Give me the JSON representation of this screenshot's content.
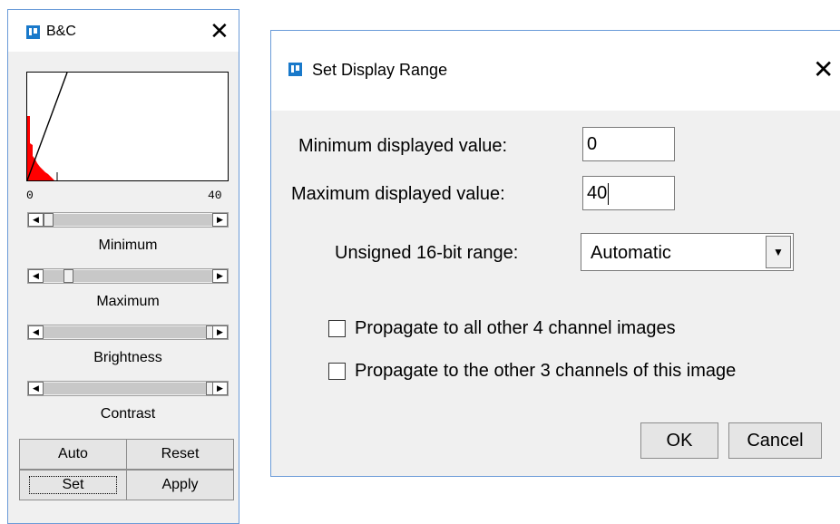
{
  "bc_window": {
    "title": "B&C",
    "histogram": {
      "min_label": "0",
      "max_label": "40"
    },
    "sliders": [
      {
        "label": "Minimum",
        "level": 0.03
      },
      {
        "label": "Maximum",
        "level": 0.13
      },
      {
        "label": "Brightness",
        "level": 0.97
      },
      {
        "label": "Contrast",
        "level": 0.97
      }
    ],
    "buttons": {
      "auto": "Auto",
      "reset": "Reset",
      "set": "Set",
      "apply": "Apply"
    }
  },
  "dialog": {
    "title": "Set Display Range",
    "min_label": "Minimum displayed value:",
    "min_value": "0",
    "max_label": "Maximum displayed value:",
    "max_value": "40",
    "range_label": "Unsigned 16-bit range:",
    "range_value": "Automatic",
    "propagate_all": "Propagate to all other 4 channel images",
    "propagate_channels": "Propagate to the other 3 channels of this image",
    "ok": "OK",
    "cancel": "Cancel"
  },
  "colors": {
    "accent": "#1979ca",
    "histogram_fill": "#ff0000",
    "border": "#6a9bd8"
  }
}
